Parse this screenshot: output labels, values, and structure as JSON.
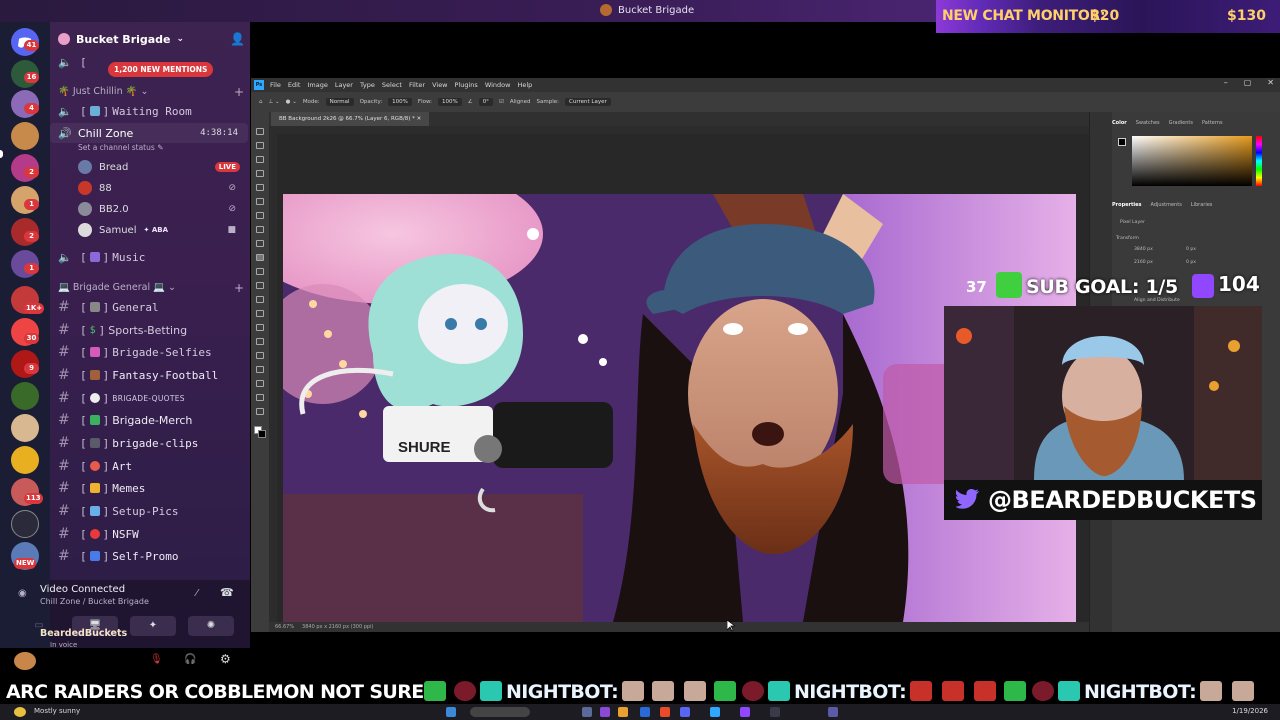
{
  "window": {
    "title": "Bucket Brigade"
  },
  "chat_monitor": {
    "label": "NEW CHAT MONITOR:",
    "amount_left": "$20",
    "amount_right": "$130"
  },
  "rail": {
    "badges": [
      "41",
      "16",
      "4",
      "2",
      "1",
      "2",
      "1",
      "2",
      "1K+",
      "30",
      "9",
      "113"
    ],
    "new_label": "NEW"
  },
  "server": {
    "name": "Bucket Brigade",
    "mentions_pill": "1,200 NEW MENTIONS",
    "categories": {
      "just_chillin": "Just Chillin",
      "brigade_general": "Brigade General"
    },
    "voice_channels": {
      "waiting_room": "Waiting Room",
      "chill_zone": "Chill Zone",
      "chill_zone_timer": "4:38:14",
      "chill_zone_status": "Set a channel status",
      "music": "Music"
    },
    "voice_users": [
      {
        "name": "Bread",
        "badge": "LIVE"
      },
      {
        "name": "88"
      },
      {
        "name": "BB2.0"
      },
      {
        "name": "Samuel",
        "tag": "ABA"
      }
    ],
    "text_channels": [
      "General",
      "Sports-Betting",
      "Brigade-Selfies",
      "Fantasy-Football",
      "BRIGADE-QUOTES",
      "Brigade-Merch",
      "brigade-clips",
      "Art",
      "Memes",
      "Setup-Pics",
      "NSFW",
      "Self-Promo"
    ]
  },
  "voice_panel": {
    "title": "Video Connected",
    "subtitle": "Chill Zone / Bucket Brigade"
  },
  "user_panel": {
    "name": "BeardedBuckets",
    "status": "In voice"
  },
  "photoshop": {
    "menu": [
      "File",
      "Edit",
      "Image",
      "Layer",
      "Type",
      "Select",
      "Filter",
      "View",
      "Plugins",
      "Window",
      "Help"
    ],
    "options": {
      "mode_label": "Mode:",
      "mode": "Normal",
      "opacity_label": "Opacity:",
      "opacity": "100%",
      "flow_label": "Flow:",
      "flow": "100%",
      "angle": "0°",
      "aligned": "Aligned",
      "sample_label": "Sample:",
      "sample": "Current Layer"
    },
    "doc_tab": "BB Background 2k26 @ 66.7% (Layer 6, RGB/8) *",
    "zoom": "66.67%",
    "doc_size": "3840 px x 2160 px (300 ppi)",
    "color_tabs": [
      "Color",
      "Swatches",
      "Gradients",
      "Patterns"
    ],
    "props_tabs": [
      "Properties",
      "Adjustments",
      "Libraries"
    ],
    "props": {
      "layer_type": "Pixel Layer",
      "transform": "Transform",
      "w": "3840 px",
      "h": "2160 px",
      "x": "0 px",
      "y": "0 px",
      "align": "Align and Distribute"
    }
  },
  "stream_overlay": {
    "sub_count_left": "37",
    "sub_goal": "SUB GOAL: 1/5",
    "sub_count_right": "104",
    "handle": "@BEARDEDBUCKETS",
    "mic_brand": "SHURE"
  },
  "ticker": {
    "message": "ARC RAIDERS OR COBBLEMON NOT SURE",
    "nightbot": "NIGHTBOT:"
  },
  "taskbar": {
    "weather": "Mostly sunny",
    "date": "1/19/2026"
  },
  "colors": {
    "accent": "#31a8ff",
    "discord_red": "#da373c",
    "monitor_gold": "#ffd06a",
    "twitch_purple": "#9146ff"
  }
}
